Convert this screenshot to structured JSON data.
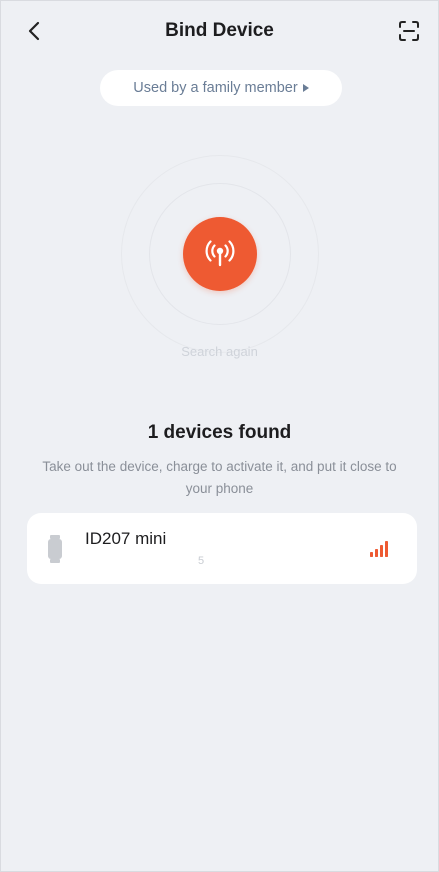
{
  "header": {
    "title": "Bind Device",
    "back_icon": "chevron-left-icon",
    "scan_icon": "scan-frame-icon"
  },
  "family_link": {
    "label": "Used by a family member",
    "arrow_icon": "triangle-right-icon"
  },
  "search": {
    "beacon_icon": "broadcast-antenna-icon",
    "search_again_label": "Search again"
  },
  "results": {
    "title": "1 devices found",
    "hint": "Take out the device, charge to activate it, and put it close to your phone"
  },
  "devices": [
    {
      "name": "ID207 mini",
      "sub": "5",
      "icon": "watch-icon",
      "signal_icon": "signal-strength-icon"
    }
  ],
  "colors": {
    "accent": "#ee5a32",
    "background": "#eef0f4",
    "link_text": "#6a7d96"
  }
}
